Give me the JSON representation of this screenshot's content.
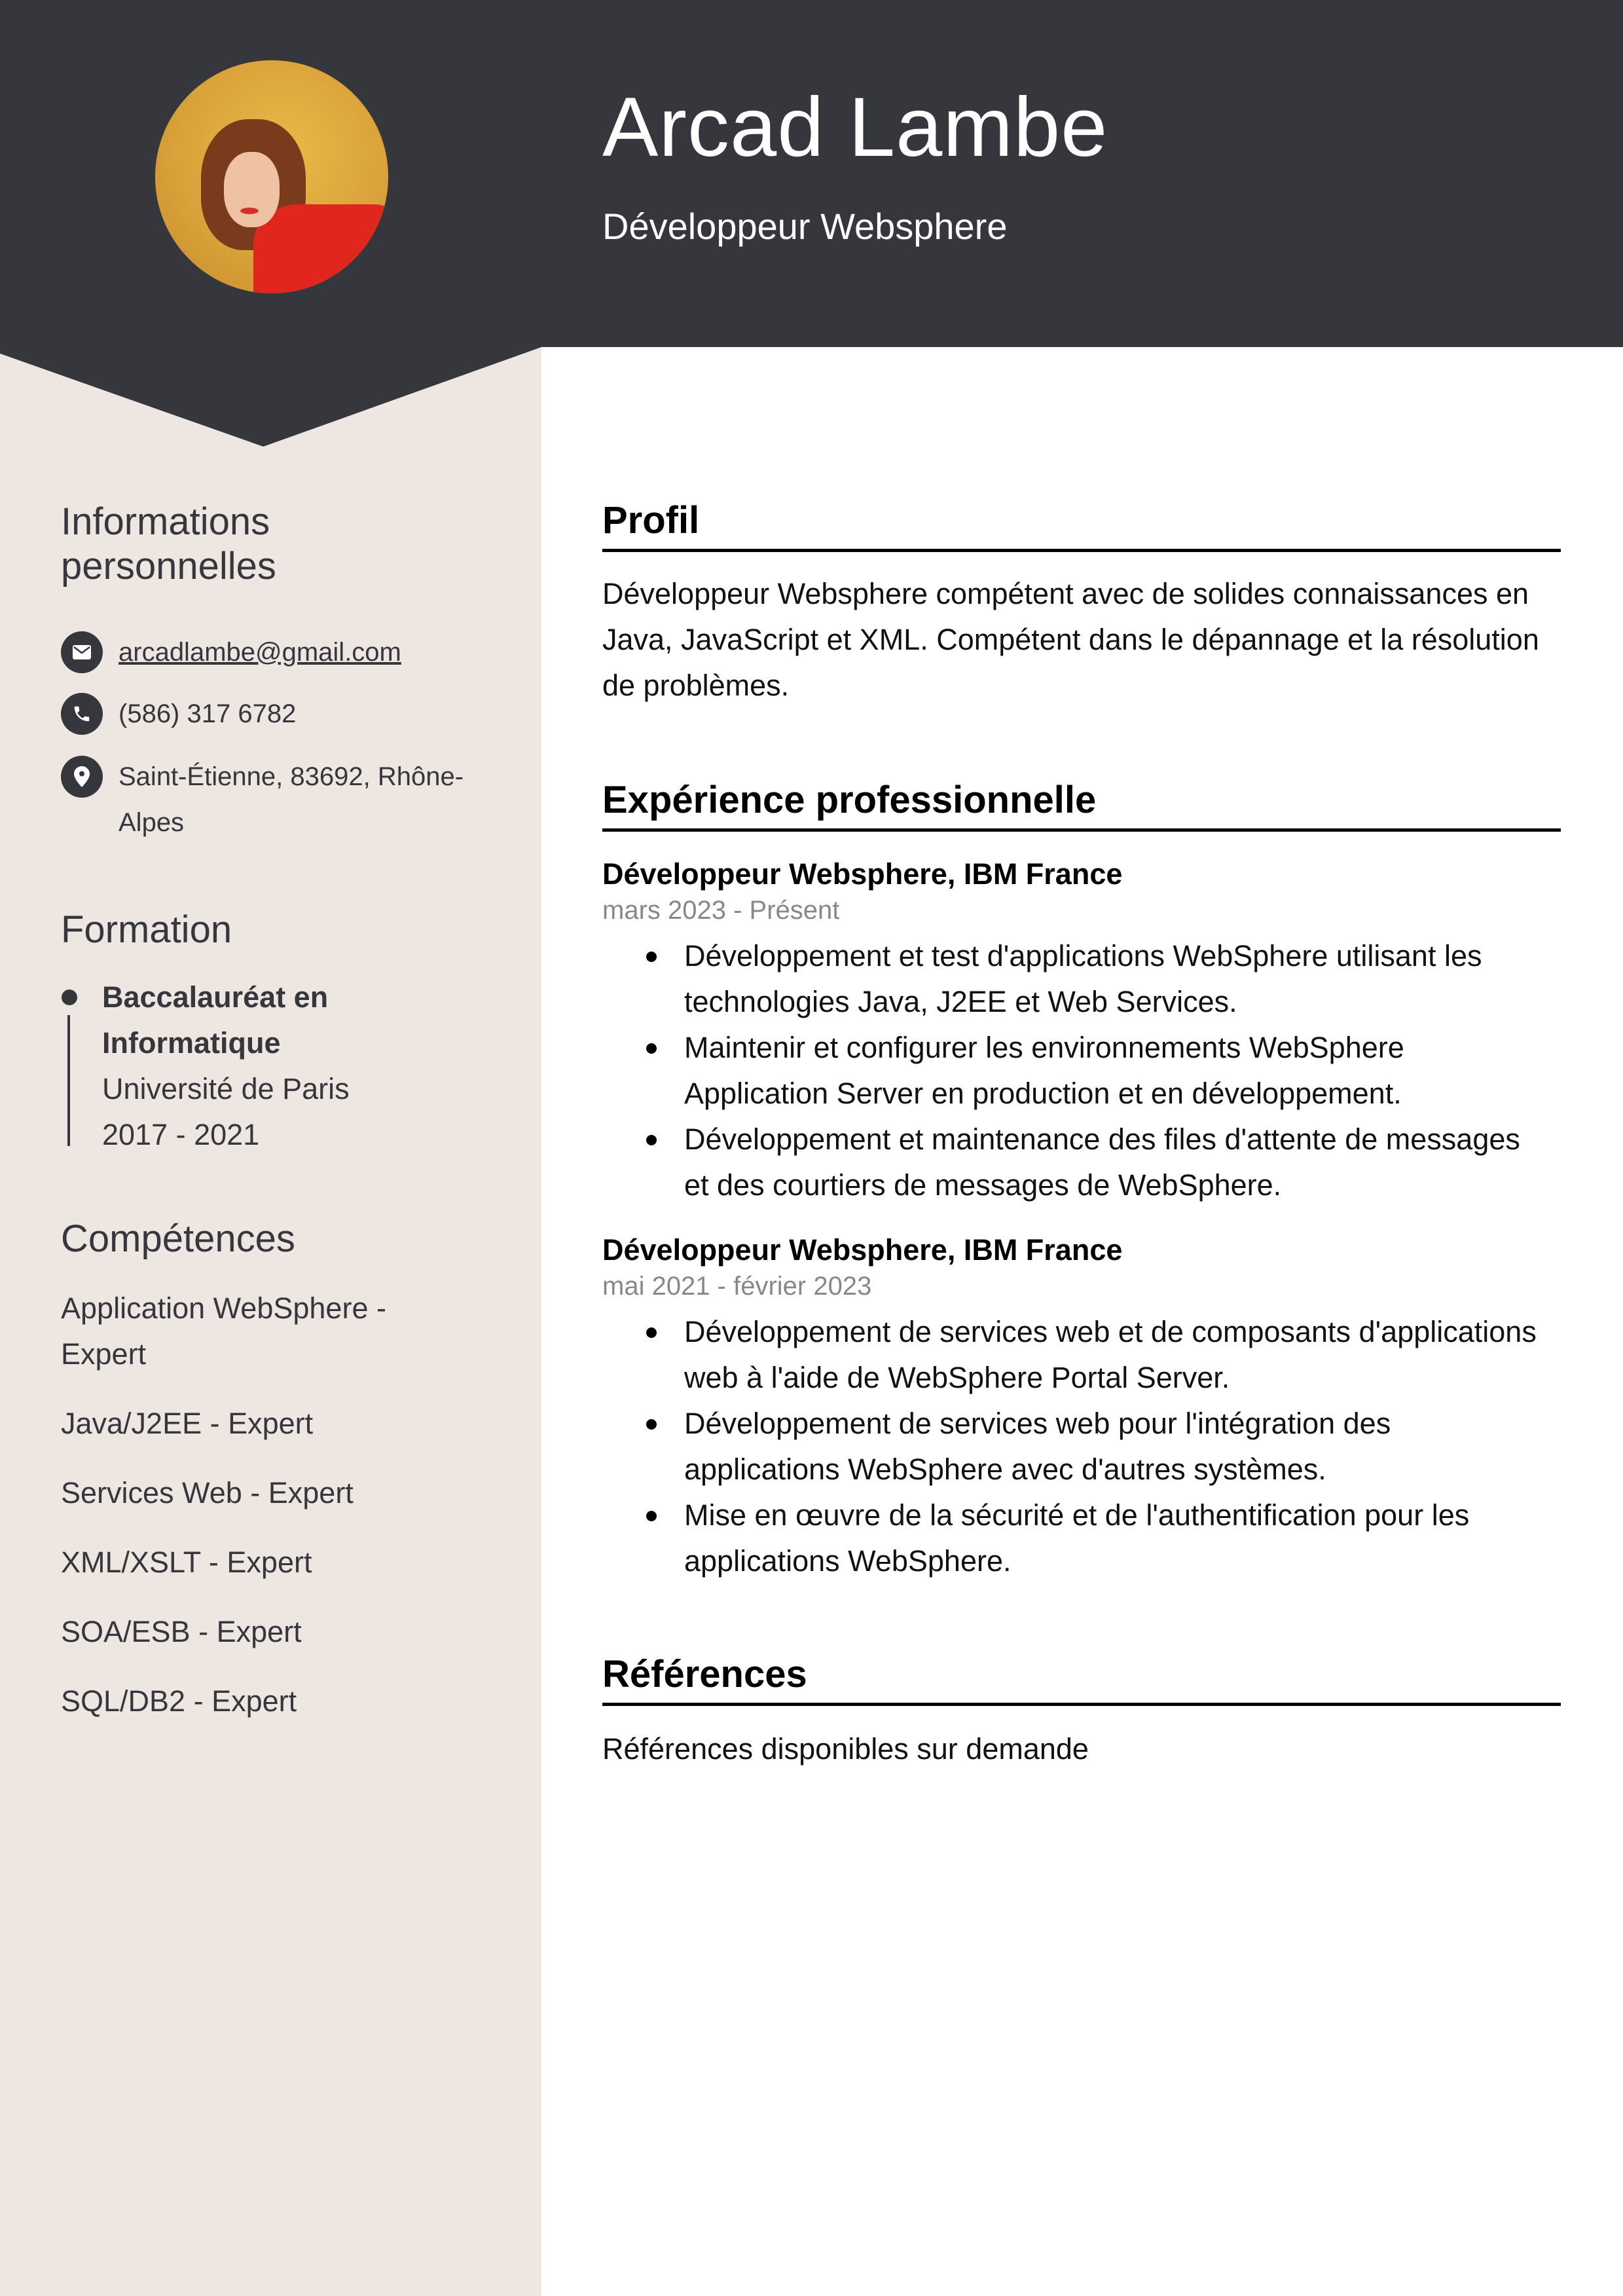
{
  "header": {
    "name": "Arcad Lambe",
    "job_title": "Développeur Websphere",
    "colors": {
      "header_bg": "#36373d",
      "sidebar_bg": "#ede6e1"
    }
  },
  "sidebar": {
    "personal_info": {
      "heading_line1": "Informations",
      "heading_line2": "personnelles",
      "email": {
        "icon": "envelope-icon",
        "value": "arcadlambe@gmail.com"
      },
      "phone": {
        "icon": "phone-icon",
        "value": "(586) 317 6782"
      },
      "address": {
        "icon": "map-pin-icon",
        "line1": "Saint-Étienne, 83692, Rhône-",
        "line2": "Alpes"
      }
    },
    "education": {
      "heading": "Formation",
      "items": [
        {
          "degree_line1": "Baccalauréat en",
          "degree_line2": "Informatique",
          "school": "Université de Paris",
          "years": "2017 - 2021"
        }
      ]
    },
    "skills": {
      "heading": "Compétences",
      "items": [
        {
          "line1": "Application WebSphere -",
          "line2": "Expert"
        },
        {
          "line1": "Java/J2EE - Expert"
        },
        {
          "line1": "Services Web - Expert"
        },
        {
          "line1": "XML/XSLT - Expert"
        },
        {
          "line1": "SOA/ESB - Expert"
        },
        {
          "line1": "SQL/DB2 - Expert"
        }
      ]
    }
  },
  "main": {
    "profile": {
      "heading": "Profil",
      "lines": [
        "Développeur Websphere compétent avec de solides connaissances en",
        "Java, JavaScript et XML. Compétent dans le dépannage et la résolution",
        "de problèmes."
      ]
    },
    "experience": {
      "heading": "Expérience professionnelle",
      "jobs": [
        {
          "title": "Développeur Websphere, IBM France",
          "dates": "mars 2023 - Présent",
          "bullets": [
            {
              "l1": "Développement et test d'applications WebSphere utilisant les",
              "l2": "technologies Java, J2EE et Web Services."
            },
            {
              "l1": "Maintenir et configurer les environnements WebSphere",
              "l2": "Application Server en production et en développement."
            },
            {
              "l1": "Développement et maintenance des files d'attente de messages",
              "l2": "et des courtiers de messages de WebSphere."
            }
          ]
        },
        {
          "title": "Développeur Websphere, IBM France",
          "dates": "mai 2021 - février 2023",
          "bullets": [
            {
              "l1": "Développement de services web et de composants d'applications",
              "l2": "web à l'aide de WebSphere Portal Server."
            },
            {
              "l1": "Développement de services web pour l'intégration des",
              "l2": "applications WebSphere avec d'autres systèmes."
            },
            {
              "l1": "Mise en œuvre de la sécurité et de l'authentification pour les",
              "l2": "applications WebSphere."
            }
          ]
        }
      ]
    },
    "references": {
      "heading": "Références",
      "text": "Références disponibles sur demande"
    }
  }
}
